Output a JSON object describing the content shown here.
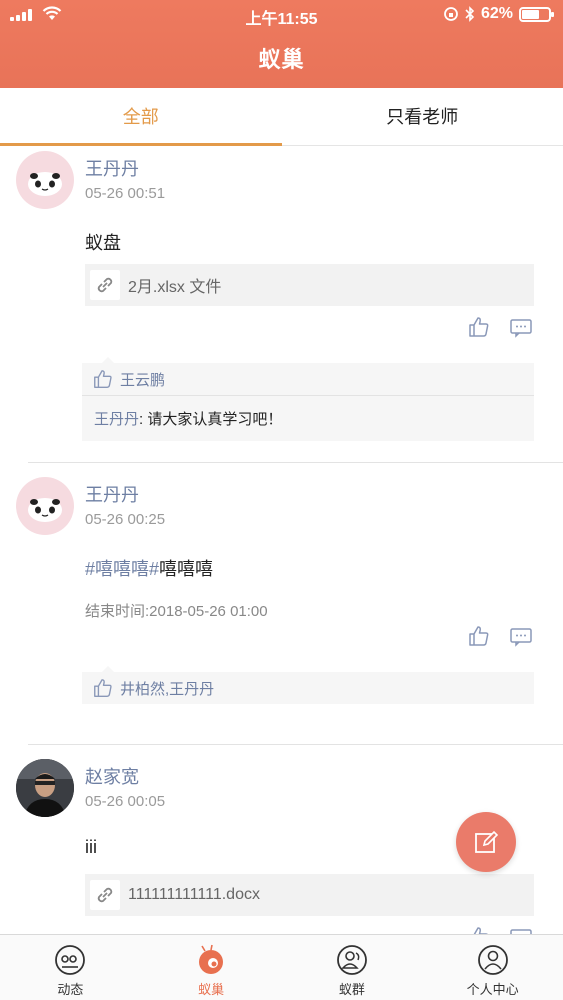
{
  "status_bar": {
    "time": "上午11:55",
    "battery": "62%",
    "battery_level": 0.62
  },
  "header": {
    "title": "蚁巢"
  },
  "tabs": [
    {
      "label": "全部",
      "active": true
    },
    {
      "label": "只看老师",
      "active": false
    }
  ],
  "posts": [
    {
      "author": "王丹丹",
      "time": "05-26 00:51",
      "content": "蚁盘",
      "attachment": "2月.xlsx 文件",
      "likes": "王云鹏",
      "comment": {
        "author": "王丹丹",
        "separator": ": ",
        "text": "请大家认真学习吧！"
      }
    },
    {
      "author": "王丹丹",
      "time": "05-26 00:25",
      "content_tag": "#嘻嘻嘻#",
      "content": "嘻嘻嘻",
      "end_time": "结束时间:2018-05-26 01:00",
      "likes": "井柏然,王丹丹"
    },
    {
      "author": "赵家宽",
      "time": "05-26 00:05",
      "content": "iii",
      "attachment": "111111111111.docx"
    }
  ],
  "tabbar": [
    {
      "label": "动态",
      "icon": "feed-icon",
      "active": false
    },
    {
      "label": "蚁巢",
      "icon": "ant-nest-icon",
      "active": true
    },
    {
      "label": "蚁群",
      "icon": "group-icon",
      "active": false
    },
    {
      "label": "个人中心",
      "icon": "profile-icon",
      "active": false
    }
  ],
  "colors": {
    "accent": "#e87358",
    "tab_active": "#e39a49",
    "name": "#6e7fa3"
  }
}
